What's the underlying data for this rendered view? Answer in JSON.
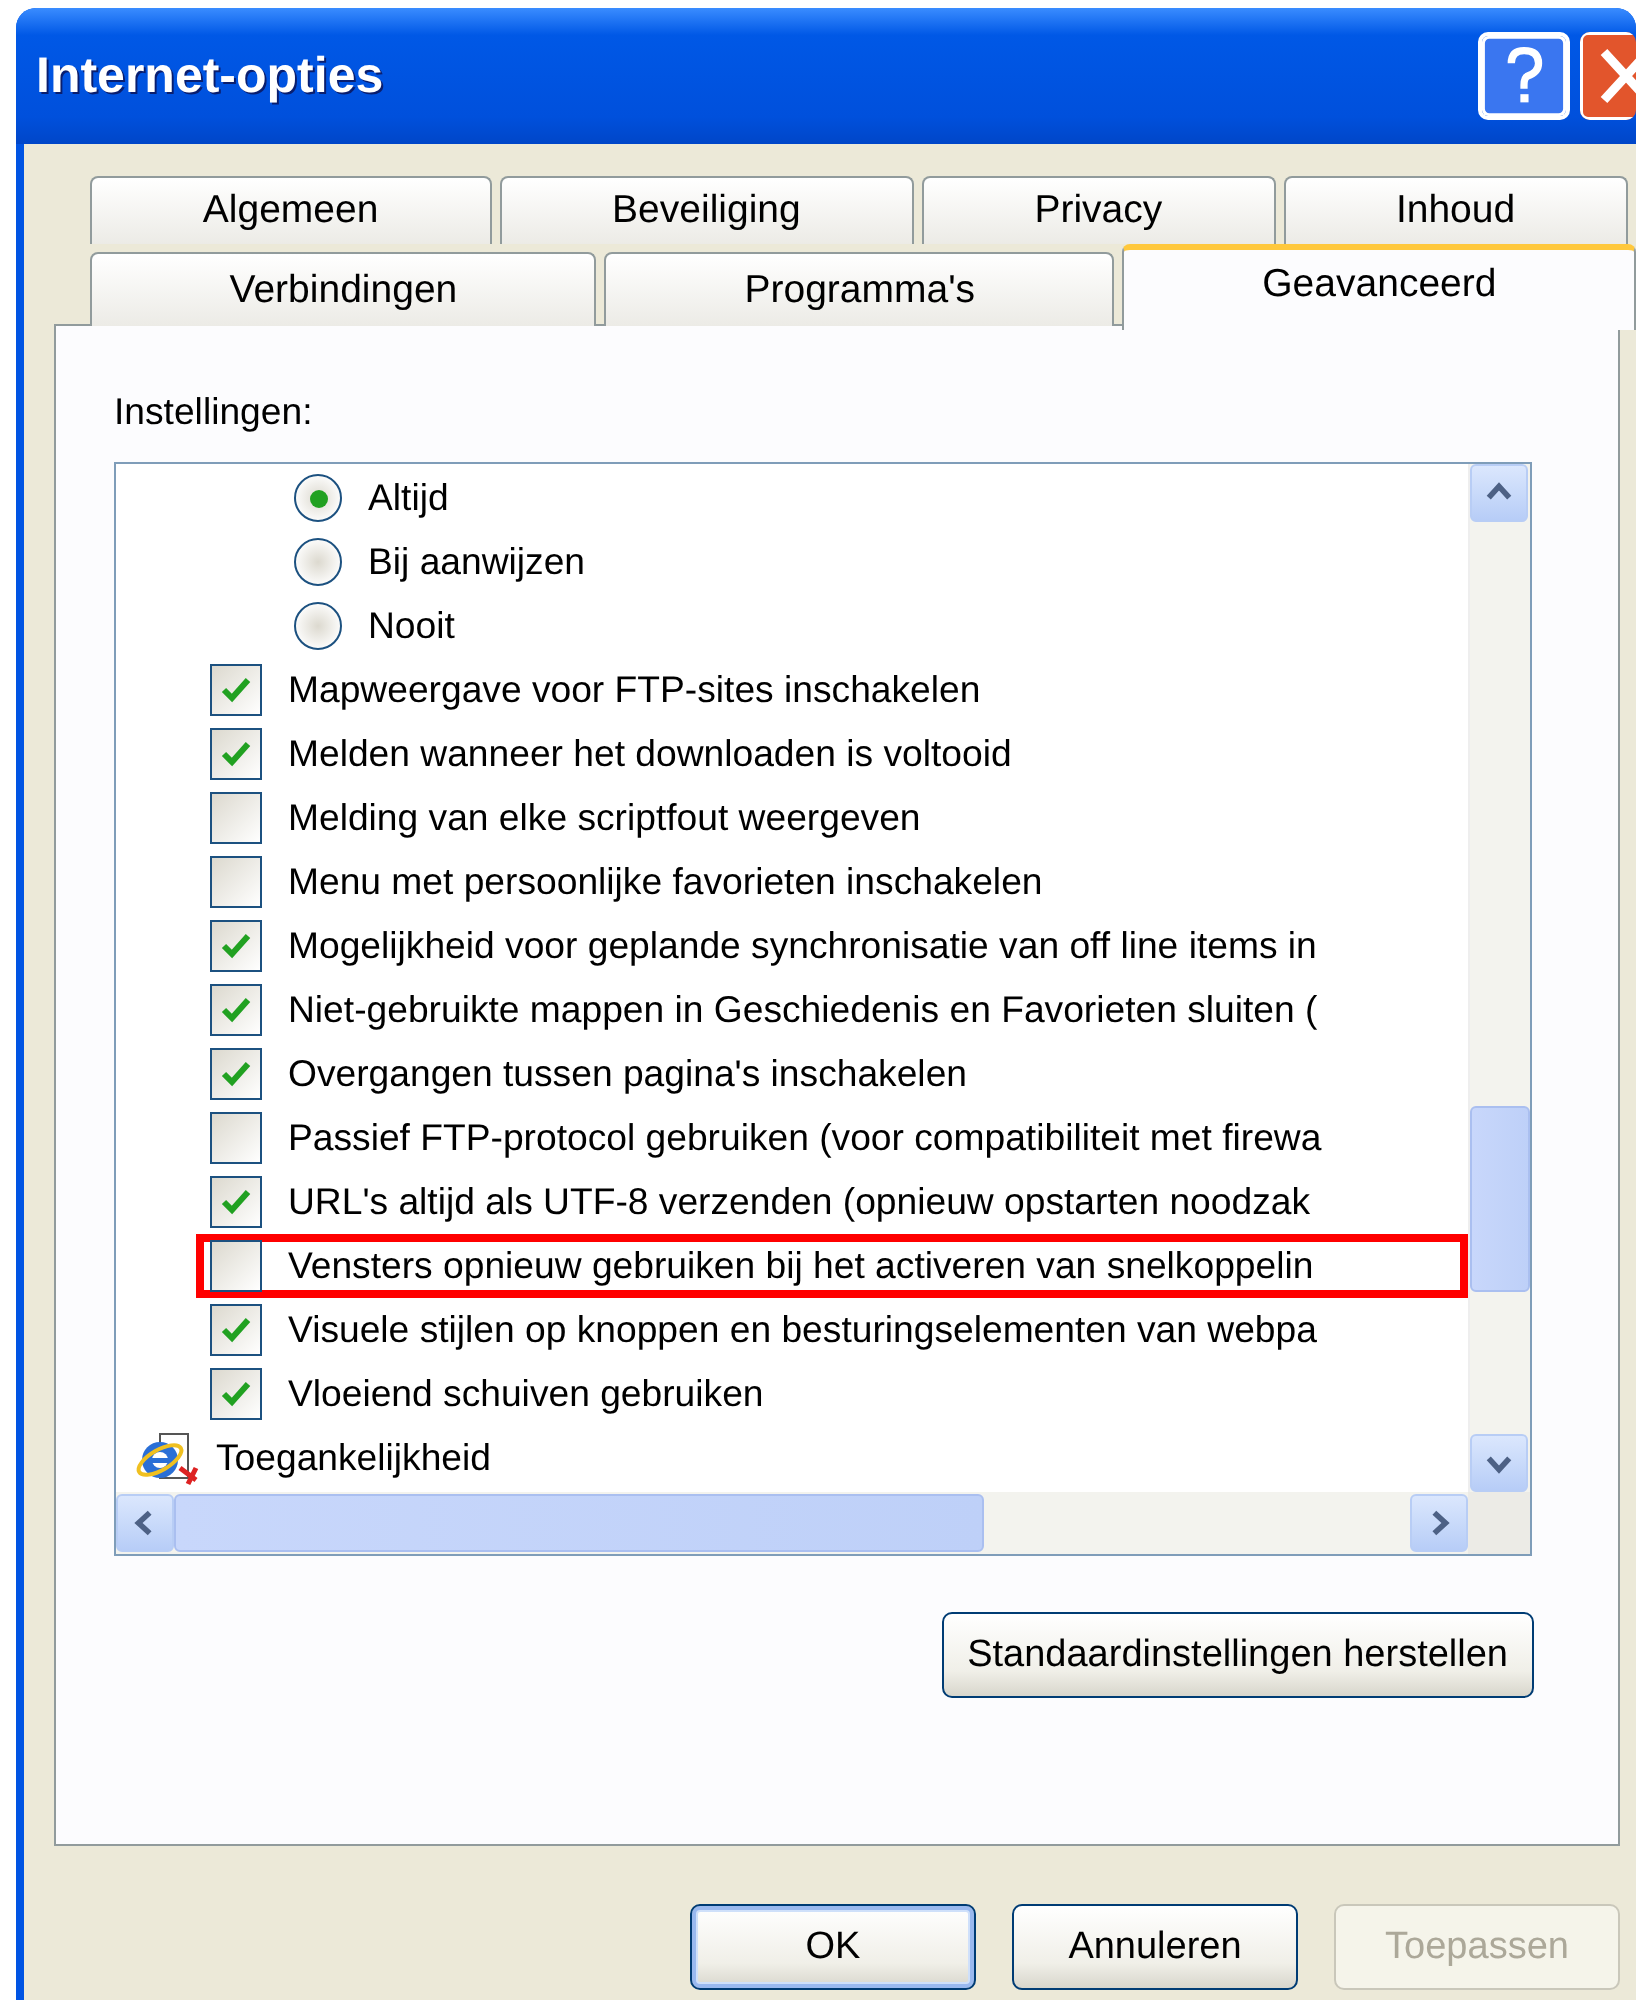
{
  "window": {
    "title": "Internet-opties"
  },
  "tab_rows": [
    [
      {
        "label": "Algemeen",
        "selected": false
      },
      {
        "label": "Beveiliging",
        "selected": false
      },
      {
        "label": "Privacy",
        "selected": false
      },
      {
        "label": "Inhoud",
        "selected": false
      }
    ],
    [
      {
        "label": "Verbindingen",
        "selected": false
      },
      {
        "label": "Programma's",
        "selected": false
      },
      {
        "label": "Geavanceerd",
        "selected": true
      }
    ]
  ],
  "settings_label": "Instellingen:",
  "settings": [
    {
      "kind": "radio",
      "label": "Altijd",
      "checked": true
    },
    {
      "kind": "radio",
      "label": "Bij aanwijzen",
      "checked": false
    },
    {
      "kind": "radio",
      "label": "Nooit",
      "checked": false
    },
    {
      "kind": "checkbox",
      "label": "Mapweergave voor FTP-sites inschakelen",
      "checked": true
    },
    {
      "kind": "checkbox",
      "label": "Melden wanneer het downloaden is voltooid",
      "checked": true
    },
    {
      "kind": "checkbox",
      "label": "Melding van elke scriptfout weergeven",
      "checked": false
    },
    {
      "kind": "checkbox",
      "label": "Menu met persoonlijke favorieten inschakelen",
      "checked": false
    },
    {
      "kind": "checkbox",
      "label": "Mogelijkheid voor geplande synchronisatie van off line items in",
      "checked": true
    },
    {
      "kind": "checkbox",
      "label": "Niet-gebruikte mappen in Geschiedenis en Favorieten sluiten (",
      "checked": true
    },
    {
      "kind": "checkbox",
      "label": "Overgangen tussen pagina's inschakelen",
      "checked": true
    },
    {
      "kind": "checkbox",
      "label": "Passief FTP-protocol gebruiken (voor compatibiliteit met firewa",
      "checked": false
    },
    {
      "kind": "checkbox",
      "label": "URL's altijd als UTF-8 verzenden (opnieuw opstarten noodzak",
      "checked": true
    },
    {
      "kind": "checkbox",
      "label": "Vensters opnieuw gebruiken bij het activeren van snelkoppelin",
      "checked": false,
      "highlighted": true
    },
    {
      "kind": "checkbox",
      "label": "Visuele stijlen op knoppen en besturingselementen van webpa",
      "checked": true
    },
    {
      "kind": "checkbox",
      "label": "Vloeiend schuiven gebruiken",
      "checked": true
    },
    {
      "kind": "category",
      "label": "Toegankelijkheid"
    }
  ],
  "restore_button": "Standaardinstellingen herstellen",
  "buttons": [
    {
      "label": "OK",
      "default": true,
      "disabled": false
    },
    {
      "label": "Annuleren",
      "default": false,
      "disabled": false
    },
    {
      "label": "Toepassen",
      "default": false,
      "disabled": true
    }
  ]
}
